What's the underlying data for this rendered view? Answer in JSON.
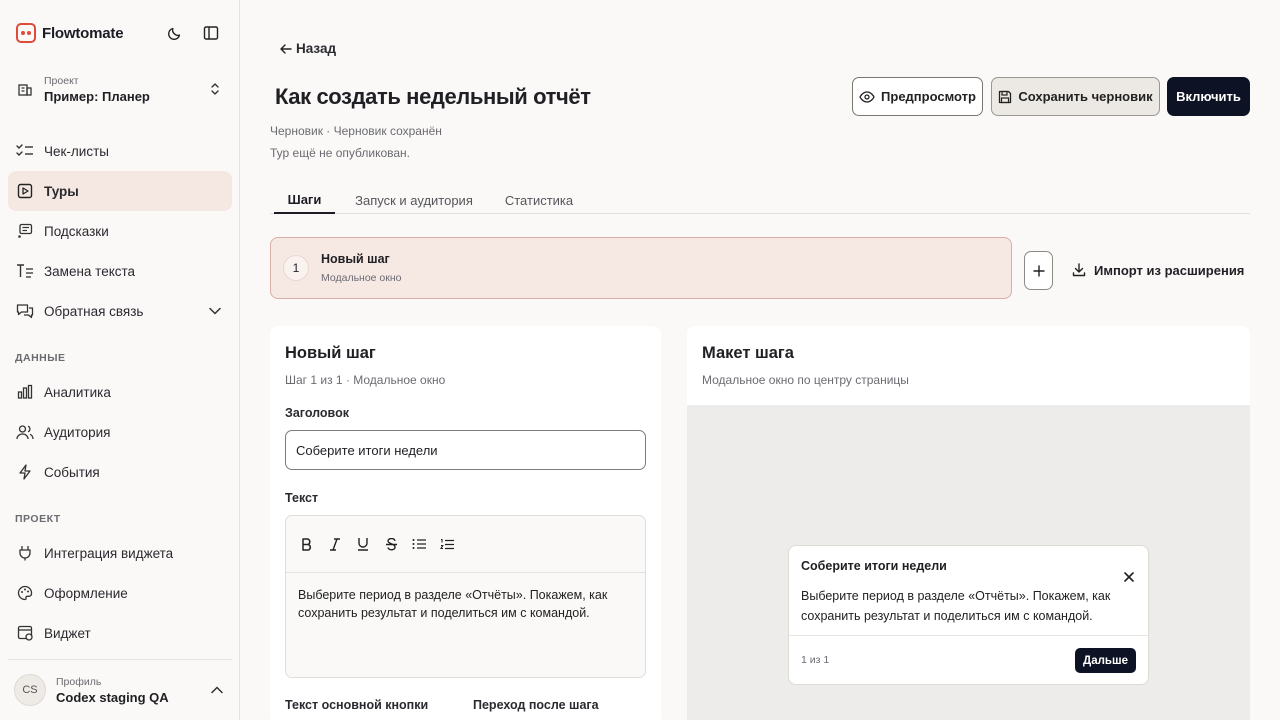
{
  "app": {
    "name": "Flowtomate"
  },
  "sidebar": {
    "project_label": "Проект",
    "project_value": "Пример: Планер",
    "nav_main": [
      {
        "label": "Чек-листы"
      },
      {
        "label": "Туры"
      },
      {
        "label": "Подсказки"
      },
      {
        "label": "Замена текста"
      },
      {
        "label": "Обратная связь"
      }
    ],
    "section_data": "ДАННЫЕ",
    "nav_data": [
      {
        "label": "Аналитика"
      },
      {
        "label": "Аудитория"
      },
      {
        "label": "События"
      }
    ],
    "section_project": "ПРОЕКТ",
    "nav_project": [
      {
        "label": "Интеграция виджета"
      },
      {
        "label": "Оформление"
      },
      {
        "label": "Виджет"
      }
    ],
    "profile": {
      "initials": "CS",
      "label": "Профиль",
      "name": "Codex staging QA"
    }
  },
  "header": {
    "back": "Назад",
    "title": "Как создать недельный отчёт",
    "status": "Черновик · Черновик сохранён",
    "note": "Тур ещё не опубликован.",
    "preview_label": "Предпросмотр",
    "save_draft_label": "Сохранить черновик",
    "enable_label": "Включить"
  },
  "tabs": [
    {
      "label": "Шаги"
    },
    {
      "label": "Запуск и аудитория"
    },
    {
      "label": "Статистика"
    }
  ],
  "steps": [
    {
      "number": "1",
      "title": "Новый шаг",
      "type": "Модальное окно"
    }
  ],
  "import_label": "Импорт из расширения",
  "editor": {
    "title": "Новый шаг",
    "subtitle": "Шаг 1 из 1 · Модальное окно",
    "heading_label": "Заголовок",
    "heading_value": "Соберите итоги недели",
    "text_label": "Текст",
    "text_value": "Выберите период в разделе «Отчёты». Покажем, как сохранить результат и поделиться им с командой.",
    "button_text_label": "Текст основной кнопки",
    "after_step_label": "Переход после шага"
  },
  "preview": {
    "title": "Макет шага",
    "subtitle": "Модальное окно по центру страницы",
    "modal_title": "Соберите итоги недели",
    "modal_text": "Выберите период в разделе «Отчёты». Покажем, как сохранить результат и поделиться им с командой.",
    "counter": "1 из 1",
    "next_label": "Дальше"
  },
  "colors": {
    "accent": "#e04a3a",
    "primary_dark": "#0d1224",
    "active_bg": "#f5e8e3"
  }
}
